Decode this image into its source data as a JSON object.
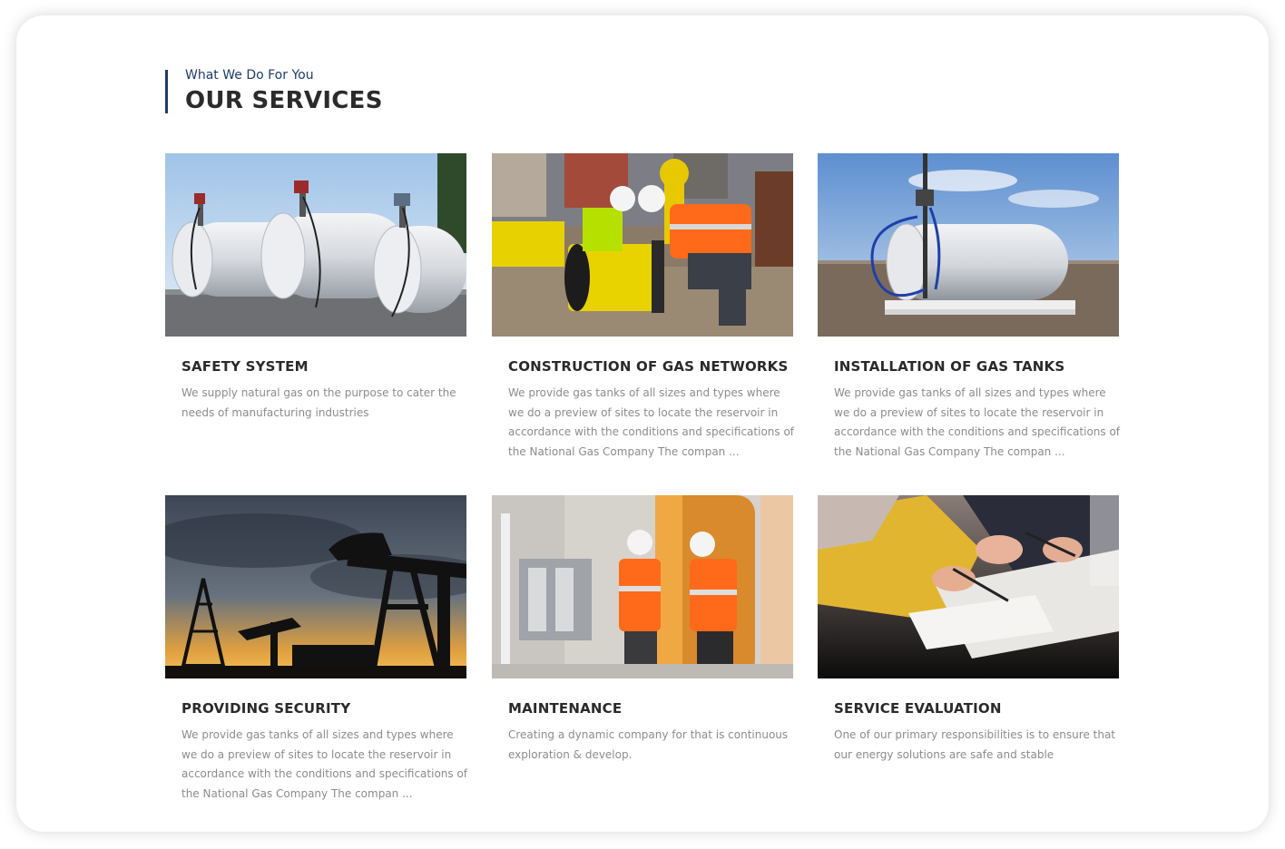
{
  "section": {
    "eyebrow": "What We Do For You",
    "title": "OUR SERVICES",
    "accent_color": "#1f3c68"
  },
  "services": [
    {
      "title": "SAFETY SYSTEM",
      "description": "We supply natural gas on the purpose to cater the needs of manufacturing industries",
      "image": "white fuel storage tanks with dispensing pumps"
    },
    {
      "title": "CONSTRUCTION OF GAS NETWORKS",
      "description": "We provide gas tanks of all sizes and types where we do a preview of sites to locate the reservoir in accordance with the conditions and specifications of the National Gas Company The compan ...",
      "image": "two workers in hard hats fitting a yellow gas pipe"
    },
    {
      "title": "INSTALLATION OF GAS TANKS",
      "description": "We provide gas tanks of all sizes and types where we do a preview of sites to locate the reservoir in accordance with the conditions and specifications of the National Gas Company The compan ...",
      "image": "single white gas tank on skid with blue hoses"
    },
    {
      "title": "PROVIDING SECURITY",
      "description": "We provide gas tanks of all sizes and types where we do a preview of sites to locate the reservoir in accordance with the conditions and specifications of the National Gas Company The compan ...",
      "image": "oil pumpjack silhouette at sunset"
    },
    {
      "title": "MAINTENANCE",
      "description": "Creating a dynamic company for that is continuous exploration & develop.",
      "image": "engineers in orange vests inspecting a plant"
    },
    {
      "title": "SERVICE EVALUATION",
      "description": "One of our primary responsibilities is to ensure that our energy solutions are safe and stable",
      "image": "people writing on documents at a meeting table"
    }
  ]
}
